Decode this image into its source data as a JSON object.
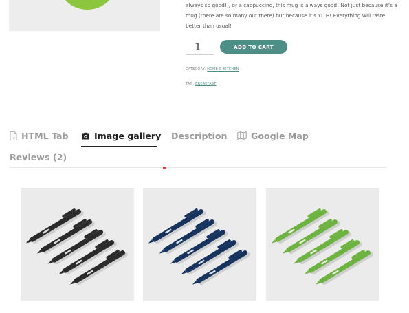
{
  "product": {
    "description": "always so good!), or a cappuccino, this mug is always good! Not just because it’s a mug (there are so many out there) but because it’s YITH! Everything will taste better than usual!",
    "quantity": "1",
    "add_to_cart_label": "ADD TO CART",
    "category_label": "CATEGORY:",
    "category_value": "HOME & KITCHEN",
    "tag_label": "TAG:",
    "tag_value": "BREAKFAST"
  },
  "tabs": {
    "html_tab": "HTML Tab",
    "image_gallery": "Image gallery",
    "description": "Description",
    "google_map": "Google Map",
    "reviews": "Reviews (2)"
  },
  "gallery": {
    "items": [
      {
        "name": "black pens",
        "color": "#2b2b2b"
      },
      {
        "name": "blue pens",
        "color": "#17345f"
      },
      {
        "name": "green pens",
        "color": "#6db33f"
      }
    ]
  },
  "colors": {
    "accent": "#4d8f87",
    "mug": "#8cc63f"
  },
  "icons": {
    "html_tab": "document-icon",
    "image_gallery": "camera-icon",
    "google_map": "map-icon"
  }
}
